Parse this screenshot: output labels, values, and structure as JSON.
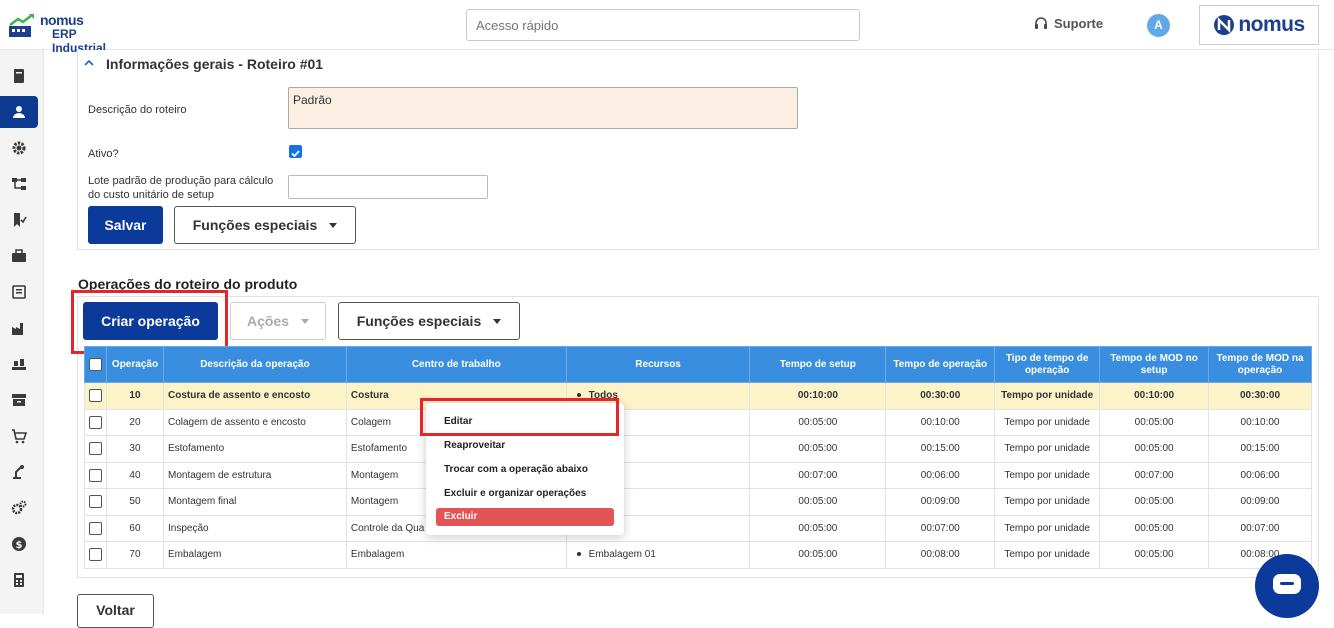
{
  "header": {
    "logo_line1": "nomus",
    "logo_line2": "ERP Industrial",
    "quick_access_placeholder": "Acesso rápido",
    "support_label": "Suporte",
    "avatar_initial": "A",
    "brand_text": "nomus"
  },
  "sidebar": {
    "items": [
      "book-icon",
      "user-icon",
      "gear-icon",
      "hierarchy-icon",
      "flag-check-icon",
      "briefcase-icon",
      "document-icon",
      "factory-icon",
      "conveyor-icon",
      "archive-icon",
      "cart-icon",
      "robot-arm-icon",
      "gears-icon",
      "dollar-icon",
      "calculator-icon"
    ],
    "active_index": 1
  },
  "general": {
    "title": "Informações gerais - Roteiro #01",
    "description_label": "Descrição do roteiro",
    "description_value": "Padrão",
    "active_label": "Ativo?",
    "active_checked": true,
    "lote_label_line1": "Lote padrão de produção para cálculo",
    "lote_label_line2": "do custo unitário de setup",
    "lote_value": "",
    "save_label": "Salvar",
    "special_functions_label": "Funções especiais"
  },
  "operations": {
    "title": "Operações do roteiro do produto",
    "create_label": "Criar operação",
    "actions_label": "Ações",
    "special_functions_label": "Funções especiais",
    "columns": [
      "Operação",
      "Descrição da operação",
      "Centro de trabalho",
      "Recursos",
      "Tempo de setup",
      "Tempo de operação",
      "Tipo de tempo de operação",
      "Tempo de MOD no setup",
      "Tempo de MOD na operação"
    ],
    "rows": [
      {
        "op": "10",
        "desc": "Costura de assento e encosto",
        "center": "Costura",
        "resource": "Todos",
        "setup": "00:10:00",
        "time": "00:30:00",
        "type": "Tempo por unidade",
        "mod_setup": "00:10:00",
        "mod_op": "00:30:00"
      },
      {
        "op": "20",
        "desc": "Colagem de assento e encosto",
        "center": "Colagem",
        "resource": "",
        "setup": "00:05:00",
        "time": "00:10:00",
        "type": "Tempo por unidade",
        "mod_setup": "00:05:00",
        "mod_op": "00:10:00"
      },
      {
        "op": "30",
        "desc": "Estofamento",
        "center": "Estofamento",
        "resource": "",
        "setup": "00:05:00",
        "time": "00:15:00",
        "type": "Tempo por unidade",
        "mod_setup": "00:05:00",
        "mod_op": "00:15:00"
      },
      {
        "op": "40",
        "desc": "Montagem de estrutura",
        "center": "Montagem",
        "resource": "",
        "setup": "00:07:00",
        "time": "00:06:00",
        "type": "Tempo por unidade",
        "mod_setup": "00:07:00",
        "mod_op": "00:06:00"
      },
      {
        "op": "50",
        "desc": "Montagem final",
        "center": "Montagem",
        "resource": "",
        "setup": "00:05:00",
        "time": "00:09:00",
        "type": "Tempo por unidade",
        "mod_setup": "00:05:00",
        "mod_op": "00:09:00"
      },
      {
        "op": "60",
        "desc": "Inspeção",
        "center": "Controle da Qua",
        "resource": "",
        "setup": "00:05:00",
        "time": "00:07:00",
        "type": "Tempo por unidade",
        "mod_setup": "00:05:00",
        "mod_op": "00:07:00"
      },
      {
        "op": "70",
        "desc": "Embalagem",
        "center": "Embalagem",
        "resource": "Embalagem 01",
        "setup": "00:05:00",
        "time": "00:08:00",
        "type": "Tempo por unidade",
        "mod_setup": "00:05:00",
        "mod_op": "00:08:00"
      }
    ]
  },
  "context_menu": {
    "edit": "Editar",
    "reuse": "Reaproveitar",
    "swap": "Trocar com a operação abaixo",
    "delete_reorder": "Excluir e organizar operações",
    "delete": "Excluir"
  },
  "footer": {
    "back_label": "Voltar"
  },
  "colors": {
    "primary": "#0b3a9a",
    "table_header": "#3a8ee0",
    "selected_row": "#fcf3c9",
    "highlight": "#e3262c",
    "delete": "#e25456"
  }
}
